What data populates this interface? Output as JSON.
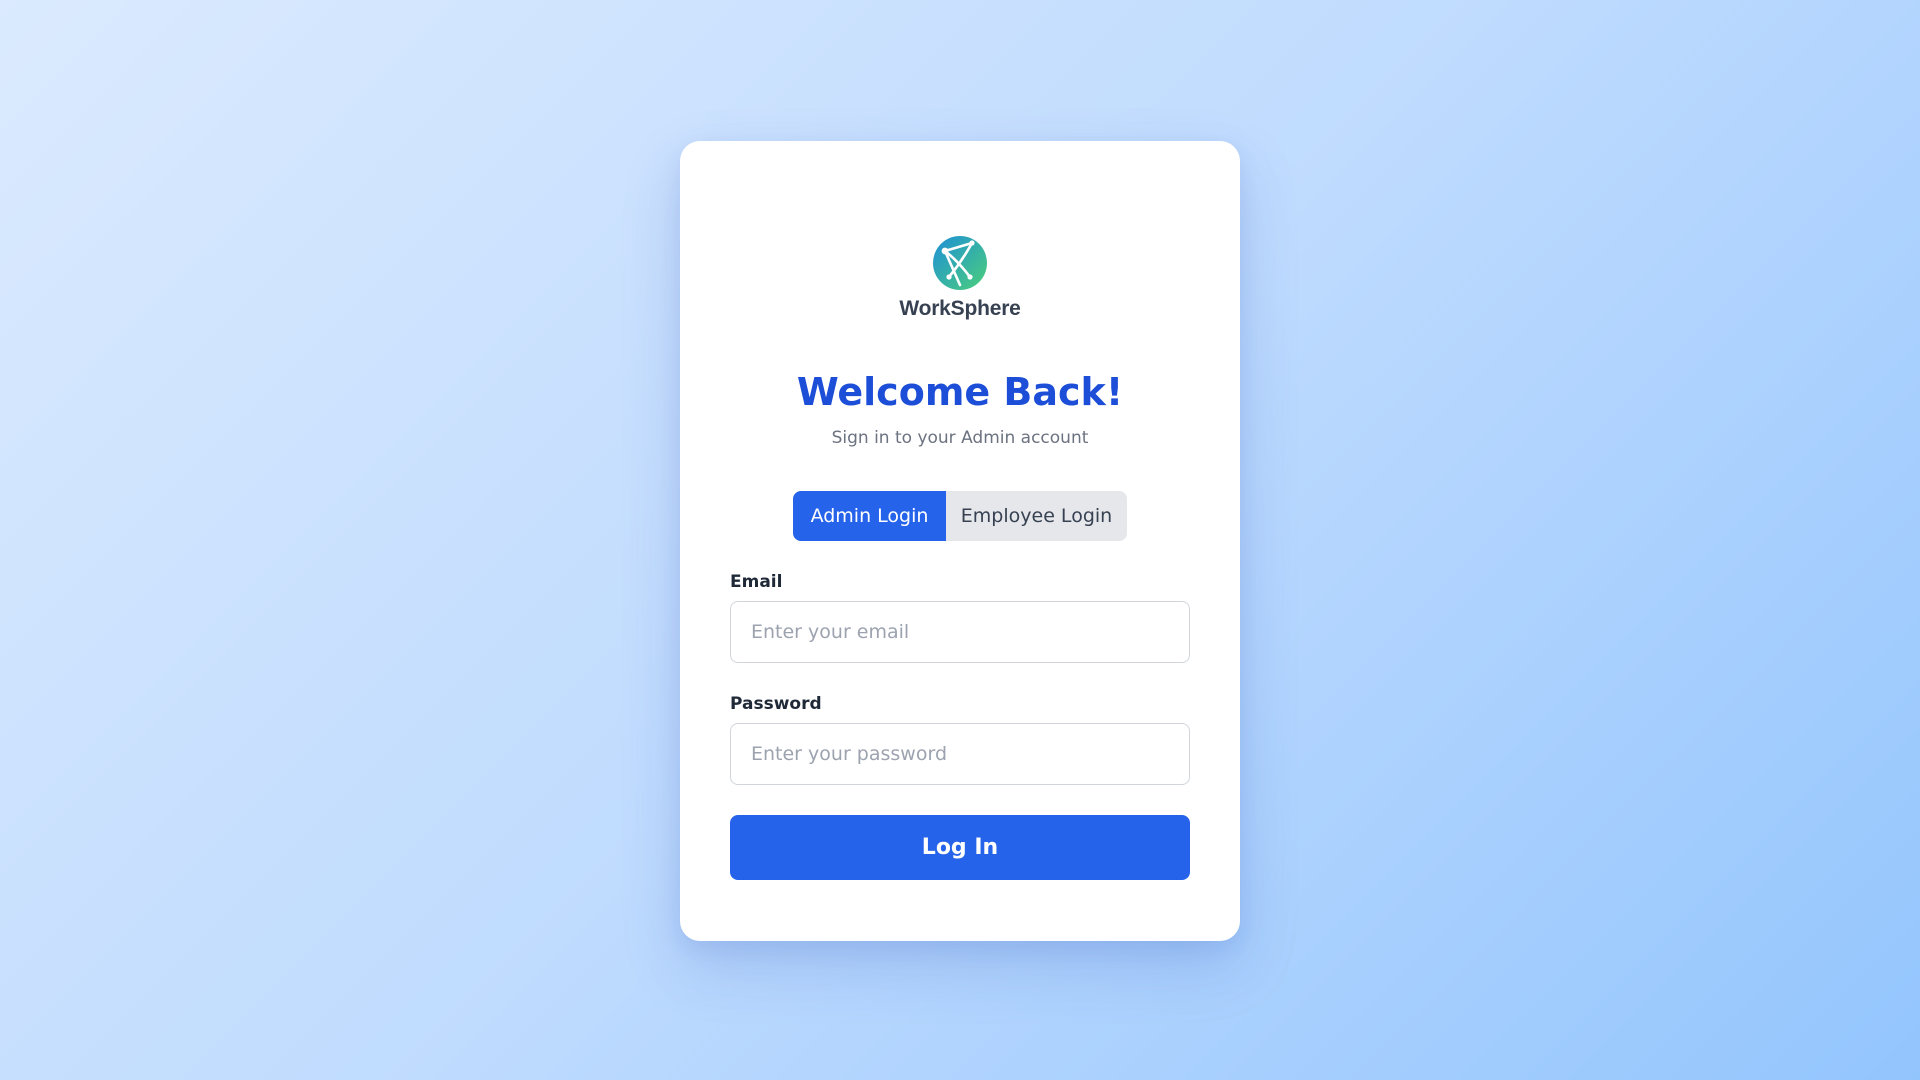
{
  "brand": {
    "name": "WorkSphere",
    "logo_icon": "globe-network-icon"
  },
  "header": {
    "title": "Welcome Back!",
    "subtitle": "Sign in to your Admin account"
  },
  "tabs": [
    {
      "label": "Admin Login",
      "active": true
    },
    {
      "label": "Employee Login",
      "active": false
    }
  ],
  "form": {
    "email": {
      "label": "Email",
      "value": "",
      "placeholder": "Enter your email"
    },
    "password": {
      "label": "Password",
      "value": "",
      "placeholder": "Enter your password"
    },
    "submit_label": "Log In"
  },
  "colors": {
    "accent": "#2563eb",
    "title": "#1d4ed8",
    "tab_inactive_bg": "#e5e7eb",
    "background_start": "#dbeafe",
    "background_end": "#93c5fd"
  }
}
